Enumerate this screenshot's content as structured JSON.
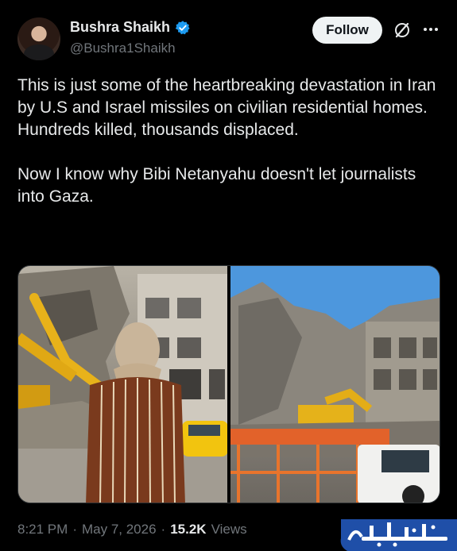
{
  "author": {
    "display_name": "Bushra Shaikh",
    "handle": "@Bushra1Shaikh",
    "verified_color": "#1d9bf0"
  },
  "actions": {
    "follow_label": "Follow",
    "grok_icon": "grok-icon",
    "more_icon": "more-icon"
  },
  "tweet": {
    "paragraphs": [
      "This is just some of the heartbreaking devastation in Iran by U.S and Israel missiles on civilian residential homes. Hundreds killed, thousands displaced.",
      "Now I know why Bibi Netanyahu doesn't let journalists into Gaza."
    ]
  },
  "media": {
    "count": 2,
    "items": [
      "photo-destroyed-building-excavator-woman",
      "photo-collapsed-building-excavator-truck"
    ]
  },
  "meta": {
    "time": "8:21 PM",
    "separator": "·",
    "date": "May 7, 2026",
    "views_count": "15.2K",
    "views_label": "Views"
  },
  "watermark": {
    "text": "تابناک",
    "color": "#1f4fa8"
  }
}
